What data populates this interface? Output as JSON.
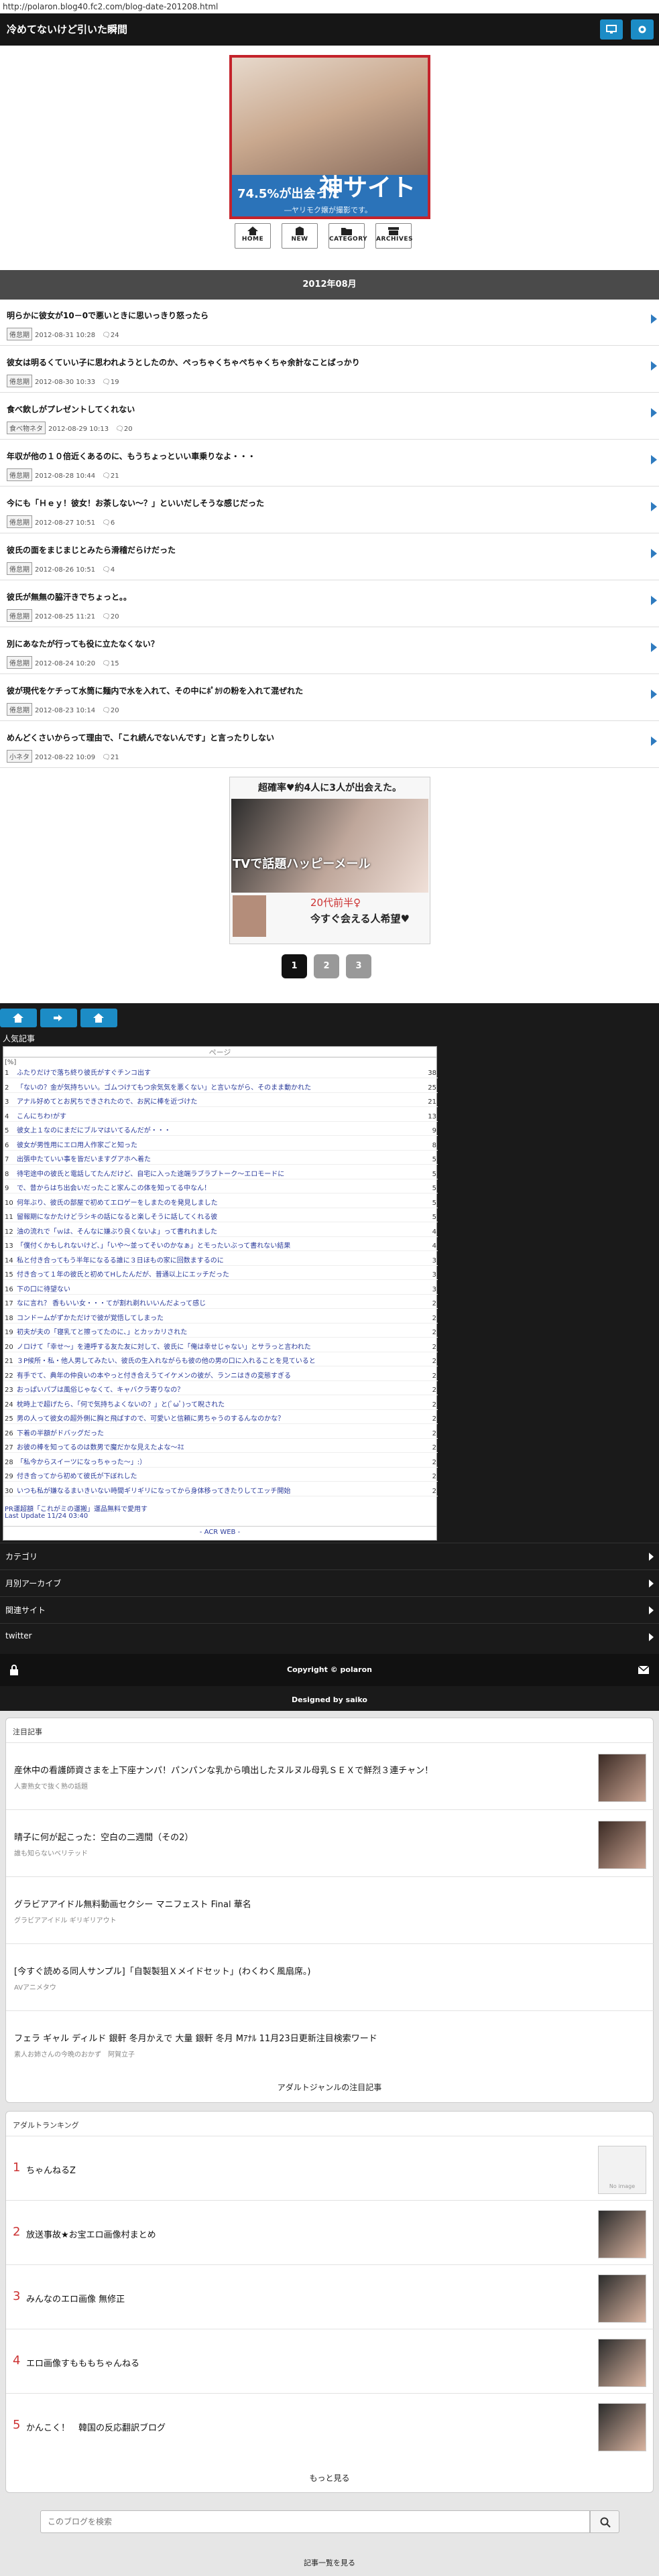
{
  "url": "http://polaron.blog40.fc2.com/blog-date-201208.html",
  "site_title": "冷めてないけど引いた瞬間",
  "hero": {
    "pct_text": "74.5%が出会った",
    "kami_text": "神サイト",
    "sub_text": "―ヤリモク嬢が撮影です。"
  },
  "nav": [
    {
      "label": "HOME",
      "icon": "home-icon"
    },
    {
      "label": "NEW",
      "icon": "new-icon"
    },
    {
      "label": "CATEGORY",
      "icon": "folder-icon"
    },
    {
      "label": "ARCHIVES",
      "icon": "archives-icon"
    }
  ],
  "month_label": "2012年08月",
  "entries": [
    {
      "title": "明らかに彼女が10－0で悪いときに思いっきり怒ったら",
      "cat": "倦怠期",
      "date": "2012-08-31 10:28",
      "comments": "24"
    },
    {
      "title": "彼女は明るくていい子に思われようとしたのか、ぺっちゃくちゃぺちゃくちゃ余計なことばっかり",
      "cat": "倦怠期",
      "date": "2012-08-30 10:33",
      "comments": "19"
    },
    {
      "title": "食べ飲しがプレゼントしてくれない",
      "cat": "食べ物ネタ",
      "date": "2012-08-29 10:13",
      "comments": "20"
    },
    {
      "title": "年収が他の１０倍近くあるのに、もうちょっといい車乗りなよ・・・",
      "cat": "倦怠期",
      "date": "2012-08-28 10:44",
      "comments": "21"
    },
    {
      "title": "今にも「Ｈｅｙ！彼女！お茶しない〜？」といいだしそうな感じだった",
      "cat": "倦怠期",
      "date": "2012-08-27 10:51",
      "comments": "6"
    },
    {
      "title": "彼氏の面をまじまじとみたら滑稽だらけだった",
      "cat": "倦怠期",
      "date": "2012-08-26 10:51",
      "comments": "4"
    },
    {
      "title": "彼氏が無無の脇汗きでちょっと。。",
      "cat": "倦怠期",
      "date": "2012-08-25 11:21",
      "comments": "20"
    },
    {
      "title": "別にあなたが行っても役に立たなくない？",
      "cat": "倦怠期",
      "date": "2012-08-24 10:20",
      "comments": "15"
    },
    {
      "title": "彼が現代をケチって水筒に麺内で水を入れて、その中にﾎﾟｶﾘの粉を入れて混ぜれた",
      "cat": "倦怠期",
      "date": "2012-08-23 10:14",
      "comments": "20"
    },
    {
      "title": "めんどくさいからって理由で、「これ続んでないんです」と言ったりしない",
      "cat": "小ネタ",
      "date": "2012-08-22 10:09",
      "comments": "21"
    }
  ],
  "ad1": {
    "top_text": "超確率♥約4人に3人が出会えた。",
    "mid_text": "TVで話題ハッピーメール",
    "b1": "20代前半♀",
    "b2": "今すぐ会える人希望♥"
  },
  "pager": [
    "1",
    "2",
    "3"
  ],
  "popular": {
    "title": "人気記事",
    "head": "ページ",
    "sub": "[%]",
    "rows": [
      {
        "n": "1",
        "t": "ふたりだけで落ち終り彼氏がすぐチンコ出す",
        "c": "38"
      },
      {
        "n": "2",
        "t": "「ないの？金が気持ちいい。ゴムつけてもつ余気気を悪くない」と言いながら、そのまま動かれた",
        "c": "25"
      },
      {
        "n": "3",
        "t": "アナル好めてとお尻ちできされたので、お尻に棒を近づけた",
        "c": "21"
      },
      {
        "n": "4",
        "t": "こんにちわ!がす",
        "c": "13"
      },
      {
        "n": "5",
        "t": "彼女上１なのにまだにブルマはいてるんだが・・・",
        "c": "9"
      },
      {
        "n": "6",
        "t": "彼女が男性用にエロ用人作家ごと知った",
        "c": "8"
      },
      {
        "n": "7",
        "t": "出張中たていい事を皆だいますグアホへ着た",
        "c": "5"
      },
      {
        "n": "8",
        "t": "待宅途中の彼氏と電話してたんだけど、自宅に入った途端ラブラブトーク〜エロモードに",
        "c": "5"
      },
      {
        "n": "9",
        "t": "で、昔からはち出会いだったこと家んこの体を知ってる中なん！",
        "c": "5"
      },
      {
        "n": "10",
        "t": "何年ぶり、彼氏の部屋で初めてエロゲーをしまたのを発見しました",
        "c": "5"
      },
      {
        "n": "11",
        "t": "留報期になかたけどラシキの話になると楽しそうに話してくれる彼",
        "c": "5"
      },
      {
        "n": "12",
        "t": "油の流れで「ｗは、そんなに嫌ぶり良くないよ」って書れれました",
        "c": "4"
      },
      {
        "n": "13",
        "t": "「僕付くかもしれないけど、」「いや〜並ってそいのかなぁ」とモったいぶって書れない結果",
        "c": "4"
      },
      {
        "n": "14",
        "t": "私と付き合ってもう半年になるる誰に３日ほもの家に回数まするのに",
        "c": "3"
      },
      {
        "n": "15",
        "t": "付き合って１年の彼氏と初めてHしたんだが、普通以上にエッチだった",
        "c": "3"
      },
      {
        "n": "16",
        "t": "下の口に待望ない",
        "c": "3"
      },
      {
        "n": "17",
        "t": "なに言れ？ 香もいい女・・・てが割れ剃れいいんだよって感じ",
        "c": "2"
      },
      {
        "n": "18",
        "t": "コンドームがずかただけで彼が覚悟してしまった",
        "c": "2"
      },
      {
        "n": "19",
        "t": "初夫が夫の「寝乳てと擦ってたのに、」とカッカリされた",
        "c": "2"
      },
      {
        "n": "20",
        "t": "ノロけて「幸せ〜」を連呼する友た友に対して、彼氏に「俺は幸せじゃない」とサラっと言われた",
        "c": "2"
      },
      {
        "n": "21",
        "t": "３P候所・私・他人男してみたい、彼氏の生入れながらも彼の他の男の口に入れることを見ていると",
        "c": "2"
      },
      {
        "n": "22",
        "t": "有手でて、典年の仲良いの本やっと付き合えうてイケメンの彼が、ランニはきの変態すぎる",
        "c": "2"
      },
      {
        "n": "23",
        "t": "おっぱいパブは風俗じゃなくて、キャバクラ寄りなの？",
        "c": "2"
      },
      {
        "n": "24",
        "t": "枕時上で超げたら、「何で気持ちよくないの？」と(ﾟωﾟ)って睨された",
        "c": "2"
      },
      {
        "n": "25",
        "t": "男の人って彼女の超外側に胸と飛ばすので、可愛いと信頼に男ちゃうのするんなのかな？",
        "c": "2"
      },
      {
        "n": "26",
        "t": "下着の半額がドバッグだった",
        "c": "2"
      },
      {
        "n": "27",
        "t": "お彼の棒を知ってるのは数男で魔だかな見えたよな〜ﾈｴ",
        "c": "2"
      },
      {
        "n": "28",
        "t": "「私今からスイーツになっちゃった〜」:）",
        "c": "2"
      },
      {
        "n": "29",
        "t": "付き合ってから初めて彼氏が下ぼれした",
        "c": "2"
      },
      {
        "n": "30",
        "t": "いつも私が嫌なるまいきいない時間ギリギリになってから身体移ってきたりしてエッチ開始",
        "c": "2"
      }
    ],
    "note": "PR運超額「これがミの運搬」運品無料で愛用す",
    "updated": "Last Update 11/24 03:40",
    "acr": "- ACR WEB -"
  },
  "side_links": [
    "カテゴリ",
    "月別アーカイブ",
    "関連サイト",
    "twitter"
  ],
  "copyright": "Copyright © polaron",
  "designed": "Designed by saiko",
  "attention": {
    "title": "注目記事",
    "items": [
      {
        "t": "産休中の看護師資さまを上下座ナンパ！パンパンな乳から噴出したヌルヌル母乳ＳＥＸで鮮烈３連チャン！",
        "s": "人妻熟女で抜く熟の話題",
        "img": true
      },
      {
        "t": "晴子に何が起こった：空白の二週間（その2）",
        "s": "誰も知らないベリテッド",
        "img": true
      },
      {
        "t": "グラビアアイドル無料動画セクシー マニフェスト Final 華名",
        "s": "グラビアアイドル ギリギリアウト",
        "img": false
      },
      {
        "t": "[今すぐ読める同人サンプル]「自製製狙Ｘメイドセット」(わくわく風扇席。)",
        "s": "AVアニメタウ",
        "img": false
      },
      {
        "t": "フェラ ギャル ディルド 銀軒 冬月かえで 大量 銀軒 冬月 Mｱﾅﾙ 11月23日更新注目検索ワード",
        "s": "素人お姉さんの今晩のおかず　阿賀立子",
        "img": false
      }
    ],
    "more": "アダルトジャンルの注目記事"
  },
  "ranking": {
    "title": "アダルトランキング",
    "items": [
      {
        "n": "1",
        "t": "ちゃんねるZ",
        "noimg": true
      },
      {
        "n": "2",
        "t": "放送事故★お宝エロ画像村まとめ",
        "noimg": false
      },
      {
        "n": "3",
        "t": "みんなのエロ画像 無修正",
        "noimg": false
      },
      {
        "n": "4",
        "t": "エロ画像すもももちゃんねる",
        "noimg": false
      },
      {
        "n": "5",
        "t": "かんこく！　韓国の反応翻訳ブログ",
        "noimg": false
      }
    ],
    "noimg_text": "No image",
    "more": "もっと見る"
  },
  "search": {
    "placeholder": "このブログを検索"
  },
  "bottom_link": "記事一覧を見る",
  "colors": {
    "accent": "#1c8cc6",
    "header": "#161616",
    "month_bar": "#4a4a4a",
    "rank_num": "#cc3333"
  }
}
